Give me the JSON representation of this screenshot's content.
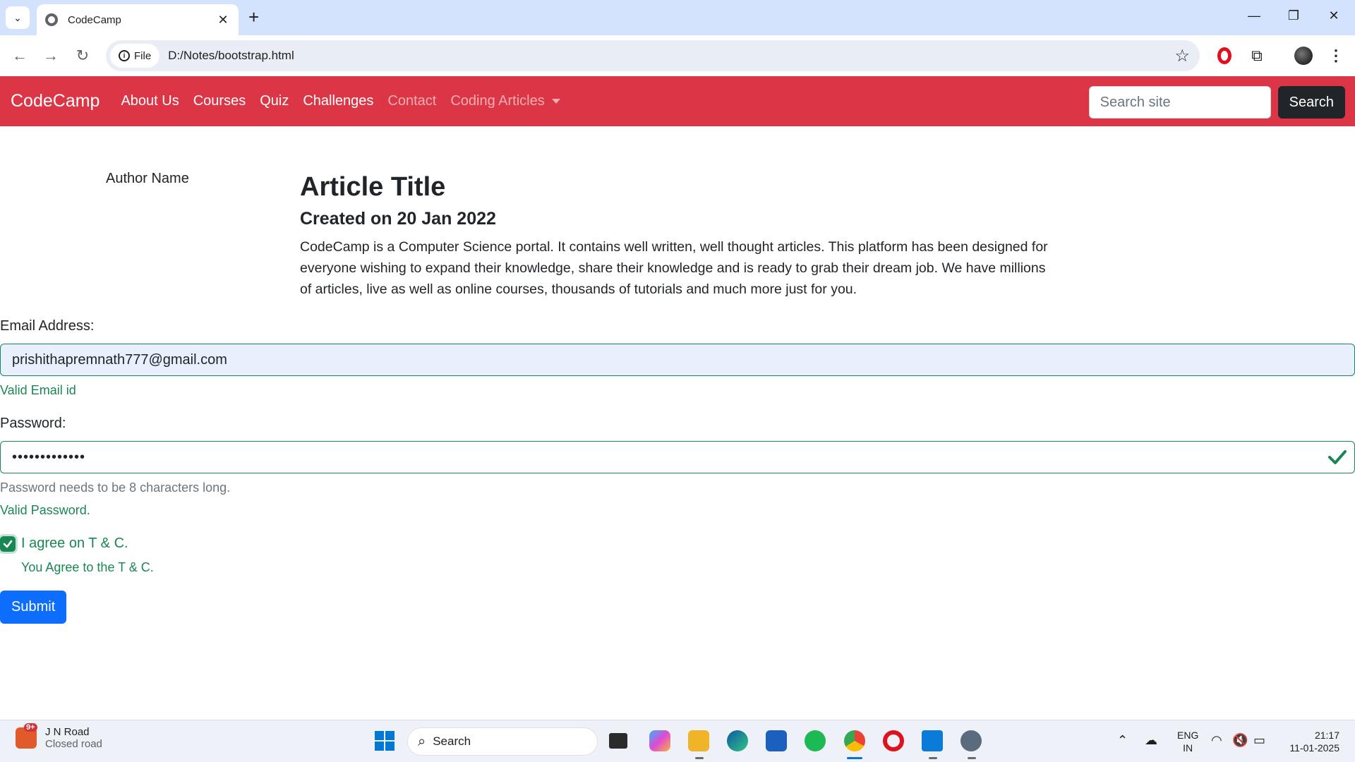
{
  "browser": {
    "tab_title": "CodeCamp",
    "site_chip": "File",
    "url": "D:/Notes/bootstrap.html"
  },
  "navbar": {
    "brand": "CodeCamp",
    "links": [
      "About Us",
      "Courses",
      "Quiz",
      "Challenges",
      "Contact",
      "Coding Articles"
    ],
    "search_placeholder": "Search site",
    "search_button": "Search",
    "color": "#dc3545"
  },
  "article": {
    "author": "Author Name",
    "title": "Article Title",
    "date": "Created on 20 Jan 2022",
    "body": "CodeCamp is a Computer Science portal. It contains well written, well thought articles. This platform has been designed for everyone wishing to expand their knowledge, share their knowledge and is ready to grab their dream job. We have millions of articles, live as well as online courses, thousands of tutorials and much more just for you."
  },
  "form": {
    "email_label": "Email Address:",
    "email_value": "prishithapremnath777@gmail.com",
    "email_feedback": "Valid Email id",
    "password_label": "Password:",
    "password_value": "•••••••••••••",
    "password_hint": "Password needs to be 8 characters long.",
    "password_feedback": "Valid Password.",
    "checkbox_label": "I agree on T & C.",
    "checkbox_feedback": "You Agree to the T & C.",
    "submit": "Submit",
    "valid_color": "#198754"
  },
  "taskbar": {
    "weather_badge": "9+",
    "weather_title": "J N Road",
    "weather_sub": "Closed road",
    "search": "Search",
    "lang_1": "ENG",
    "lang_2": "IN",
    "time": "21:17",
    "date": "11-01-2025"
  }
}
